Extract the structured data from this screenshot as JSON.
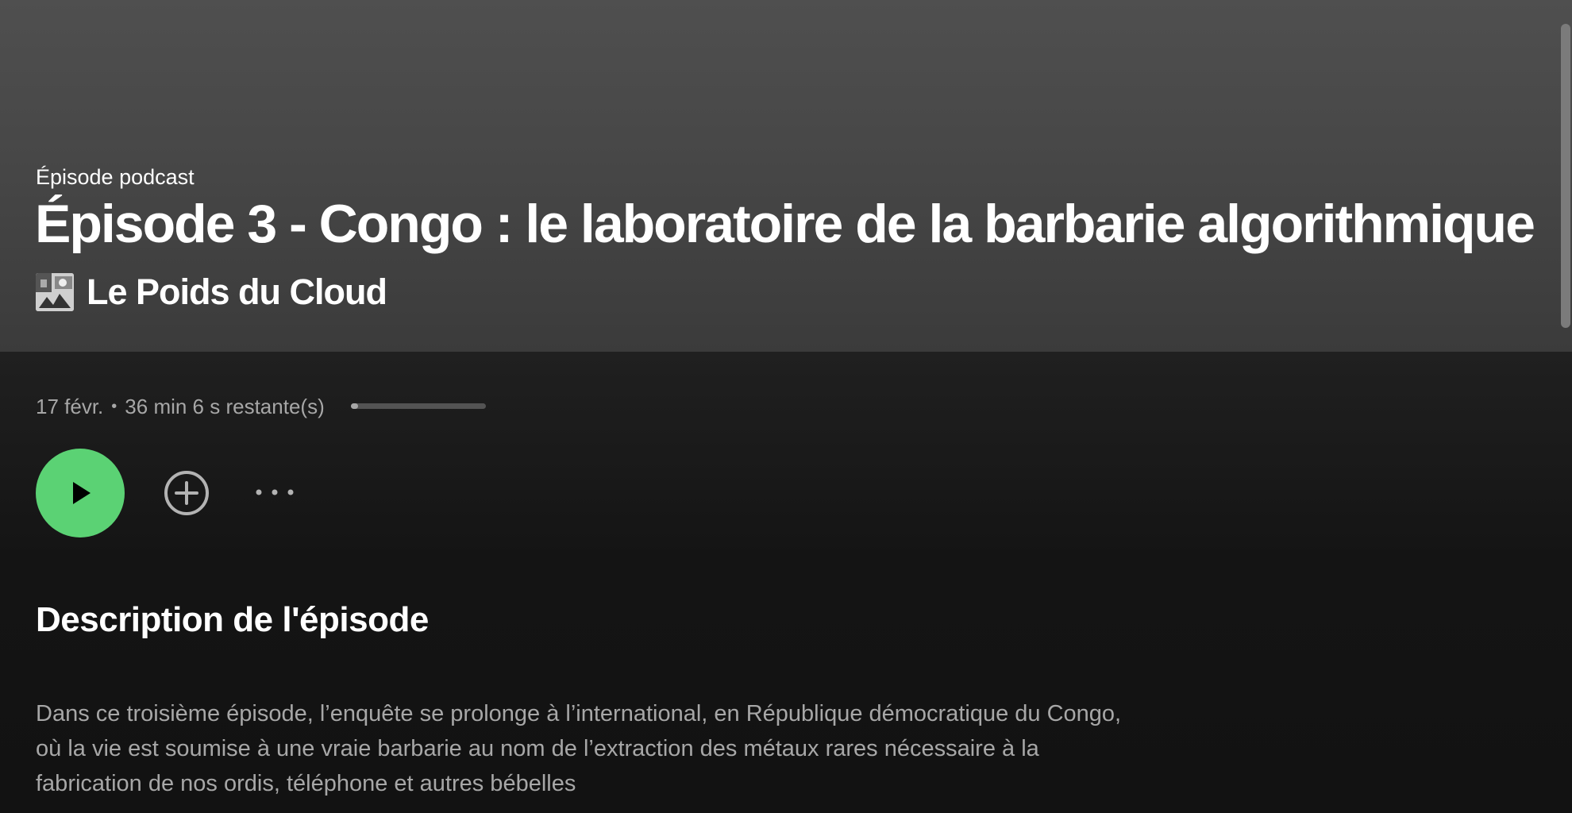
{
  "hero": {
    "type_label": "Épisode podcast",
    "title": "Épisode 3 - Congo : le laboratoire de la barbarie algorithmique",
    "show_name": "Le Poids du Cloud",
    "background_color": "#4f4f4f"
  },
  "meta": {
    "date": "17 févr.",
    "separator": "•",
    "remaining": "36 min 6 s restante(s)",
    "progress_fraction": 0.05
  },
  "actions": {
    "play_icon": "play-icon",
    "add_icon": "plus-circle-icon",
    "more_icon": "more-horizontal-icon",
    "accent_color": "#5bd274"
  },
  "description": {
    "heading": "Description de l'épisode",
    "text": "Dans ce troisième épisode, l’enquête se prolonge à l’international, en République démocratique du Congo, où la vie est soumise à une vraie barbarie au nom de l’extraction des métaux rares nécessaire à la fabrication de nos ordis, téléphone et autres bébelles"
  }
}
